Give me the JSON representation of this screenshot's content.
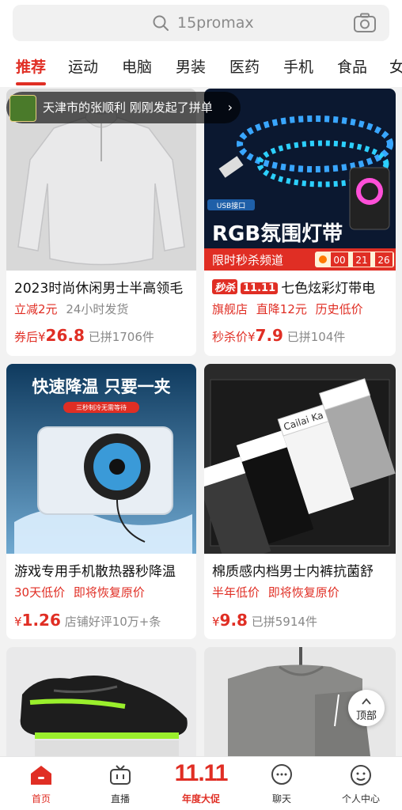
{
  "search": {
    "placeholder": "15promax"
  },
  "tabs": [
    "推荐",
    "运动",
    "电脑",
    "男装",
    "医药",
    "手机",
    "食品",
    "女"
  ],
  "toast": {
    "text": "天津市的张顺利 刚刚发起了拼单",
    "chevron": "›"
  },
  "products": [
    {
      "title": "2023时尚休闲男士半高领毛",
      "tag1": "立减2元",
      "tag2": "24小时发货",
      "price_prefix": "券后¥",
      "price": "26.8",
      "sold": "已拼1706件"
    },
    {
      "badge_sale": "秒杀",
      "badge_1111": "11.11",
      "title": "七色炫彩灯带电",
      "tag1": "旗舰店",
      "tag2": "直降12元",
      "tag3": "历史低价",
      "price_prefix": "秒杀价¥",
      "price": "7.9",
      "sold": "已拼104件",
      "image_text": {
        "usb": "USB接口",
        "headline": "RGB氛围灯带",
        "channel": "限时秒杀频道",
        "timer": [
          "00",
          "21",
          "26"
        ]
      }
    },
    {
      "title": "游戏专用手机散热器秒降温",
      "tag1": "30天低价",
      "tag2": "即将恢复原价",
      "price_prefix": "¥",
      "price": "1.26",
      "sold": "店铺好评10万+条",
      "image_text": {
        "headline": "快速降温 只要一夹",
        "sub": "三秒制冷无需等待"
      }
    },
    {
      "title": "棉质感内档男士内裤抗菌舒",
      "tag1": "半年低价",
      "tag2": "即将恢复原价",
      "price_prefix": "¥",
      "price": "9.8",
      "sold": "已拼5914件",
      "image_text": {
        "brand": "Cailai Ka"
      }
    }
  ],
  "back_to_top": "顶部",
  "bottom_nav": [
    {
      "label": "首页",
      "icon": "home-icon"
    },
    {
      "label": "直播",
      "icon": "tv-icon"
    },
    {
      "big": "11.11",
      "label": "年度大促"
    },
    {
      "label": "聊天",
      "icon": "chat-icon"
    },
    {
      "label": "个人中心",
      "icon": "profile-icon"
    }
  ],
  "colors": {
    "accent": "#e02e24",
    "bg": "#f2f2f2"
  }
}
